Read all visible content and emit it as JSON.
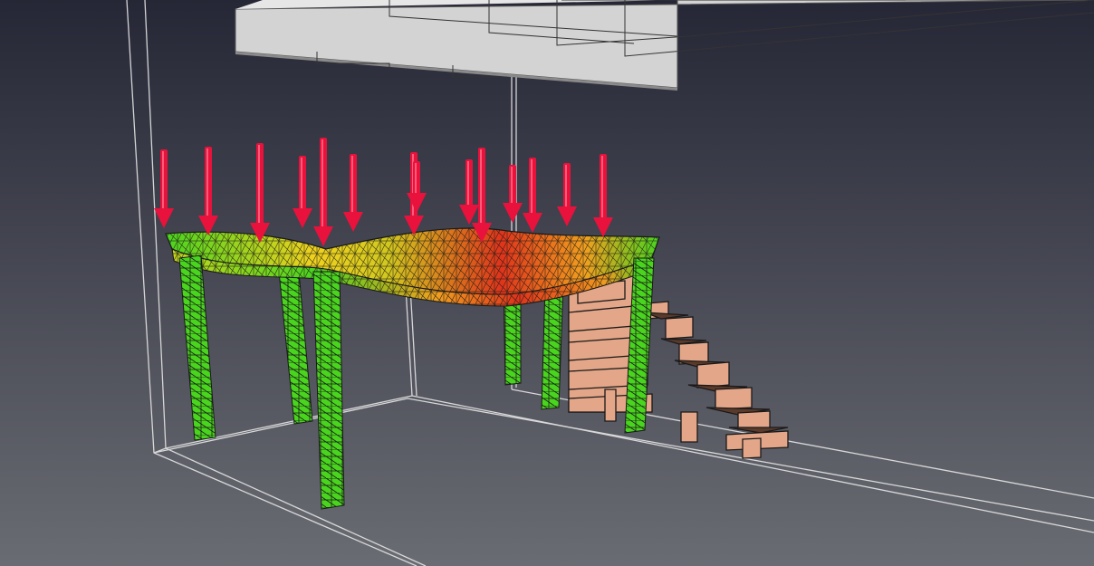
{
  "viewport": {
    "background_top": "#262736",
    "background_bottom": "#6a6c73"
  },
  "scene": {
    "load_arrow_color": "#e8123c",
    "mesh_edge_color": "#1a1a1a",
    "stair_color": "#e4a688",
    "ceiling_color": "#d3d3d3",
    "wireframe_color": "#e6e6e6",
    "stress_scale": {
      "low": "#49d41e",
      "mid": "#f0d21e",
      "high": "#e0341b"
    },
    "icons": [
      "load-arrow-icon",
      "fem-mesh-icon"
    ]
  }
}
